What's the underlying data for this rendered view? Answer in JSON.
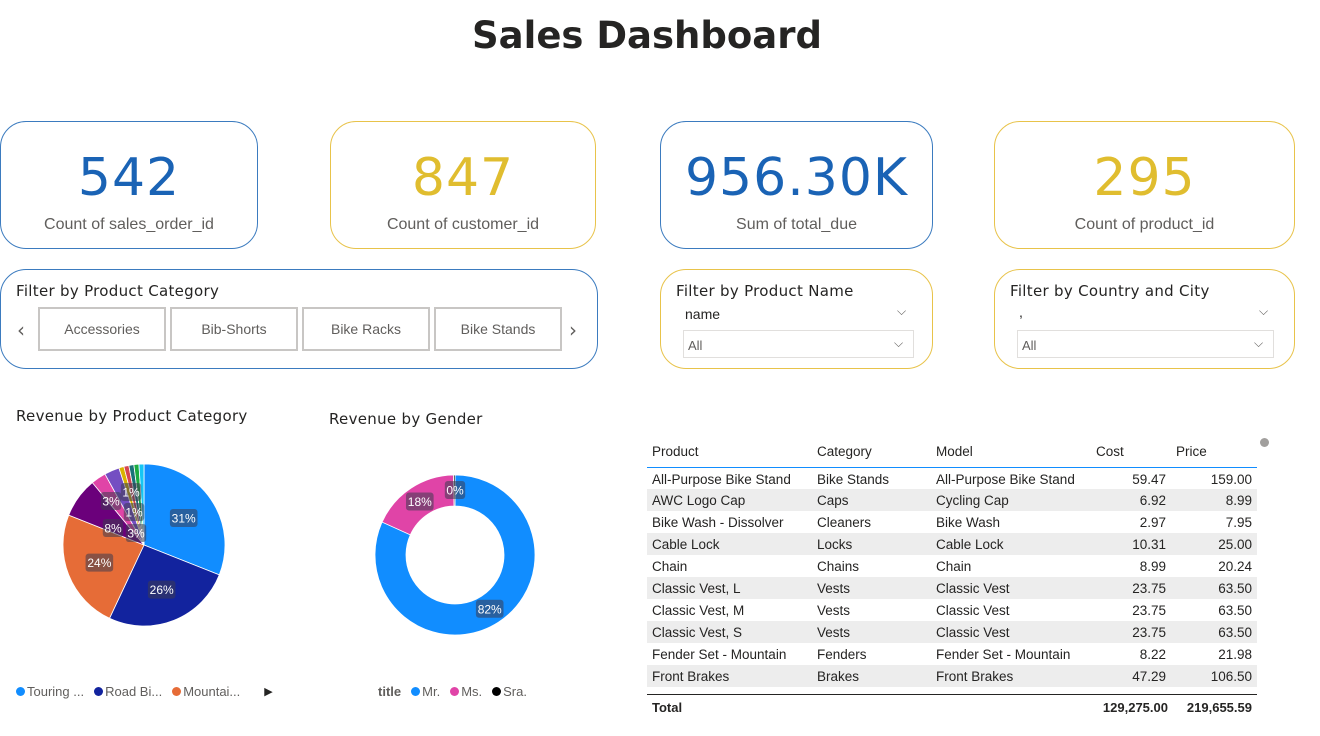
{
  "title": "Sales Dashboard",
  "kpis": [
    {
      "value": "542",
      "label": "Count of sales_order_id",
      "color": "#1a63b5"
    },
    {
      "value": "847",
      "label": "Count of customer_id",
      "color": "#e0bd2f"
    },
    {
      "value": "956.30K",
      "label": "Sum of total_due",
      "color": "#1a63b5"
    },
    {
      "value": "295",
      "label": "Count of product_id",
      "color": "#e0bd2f"
    }
  ],
  "category_slicer": {
    "title": "Filter by Product Category",
    "tiles": [
      "Accessories",
      "Bib-Shorts",
      "Bike Racks",
      "Bike Stands"
    ],
    "prev_icon": "chevron-left-icon",
    "next_icon": "chevron-right-icon"
  },
  "product_slicer": {
    "title": "Filter by Product Name",
    "field": "name",
    "value": "All"
  },
  "country_slicer": {
    "title": "Filter by Country and City",
    "field": ",",
    "value": "All"
  },
  "chart_data": [
    {
      "type": "pie",
      "title": "Revenue by Product Category",
      "slices": [
        {
          "name": "Touring ...",
          "value": 31,
          "label": "31%",
          "color": "#118dff"
        },
        {
          "name": "Road Bi...",
          "value": 26,
          "label": "26%",
          "color": "#12239e"
        },
        {
          "name": "Mountai...",
          "value": 24,
          "label": "24%",
          "color": "#e66c37"
        },
        {
          "name": "",
          "value": 8,
          "label": "8%",
          "color": "#6b007b"
        },
        {
          "name": "",
          "value": 3,
          "label": "3%",
          "color": "#e044a7"
        },
        {
          "name": "",
          "value": 3,
          "label": "3%",
          "color": "#744ec2"
        },
        {
          "name": "",
          "value": 1,
          "label": "1%",
          "color": "#d9b300"
        },
        {
          "name": "",
          "value": 1,
          "label": "1%",
          "color": "#d64550"
        },
        {
          "name": "",
          "value": 1,
          "label": "",
          "color": "#197278"
        },
        {
          "name": "",
          "value": 1,
          "label": "",
          "color": "#1aab40"
        },
        {
          "name": "",
          "value": 1,
          "label": "",
          "color": "#15c6f4"
        }
      ],
      "legend": [
        "Touring ...",
        "Road Bi...",
        "Mountai..."
      ],
      "legend_placement": "bottom"
    },
    {
      "type": "donut",
      "title": "Revenue by Gender",
      "slices": [
        {
          "name": "Mr.",
          "value": 82,
          "label": "82%",
          "color": "#118dff"
        },
        {
          "name": "Ms.",
          "value": 18,
          "label": "18%",
          "color": "#e044a7"
        },
        {
          "name": "Sra.",
          "value": 0.3,
          "label": "0%",
          "color": "#000000"
        }
      ],
      "legend_title": "title",
      "legend": [
        "Mr.",
        "Ms.",
        "Sra."
      ],
      "legend_placement": "bottom"
    }
  ],
  "table": {
    "columns": [
      "Product",
      "Category",
      "Model",
      "Cost",
      "Price"
    ],
    "rows": [
      [
        "All-Purpose Bike Stand",
        "Bike Stands",
        "All-Purpose Bike Stand",
        "59.47",
        "159.00"
      ],
      [
        "AWC Logo Cap",
        "Caps",
        "Cycling Cap",
        "6.92",
        "8.99"
      ],
      [
        "Bike Wash - Dissolver",
        "Cleaners",
        "Bike Wash",
        "2.97",
        "7.95"
      ],
      [
        "Cable Lock",
        "Locks",
        "Cable Lock",
        "10.31",
        "25.00"
      ],
      [
        "Chain",
        "Chains",
        "Chain",
        "8.99",
        "20.24"
      ],
      [
        "Classic Vest, L",
        "Vests",
        "Classic Vest",
        "23.75",
        "63.50"
      ],
      [
        "Classic Vest, M",
        "Vests",
        "Classic Vest",
        "23.75",
        "63.50"
      ],
      [
        "Classic Vest, S",
        "Vests",
        "Classic Vest",
        "23.75",
        "63.50"
      ],
      [
        "Fender Set - Mountain",
        "Fenders",
        "Fender Set - Mountain",
        "8.22",
        "21.98"
      ],
      [
        "Front Brakes",
        "Brakes",
        "Front Brakes",
        "47.29",
        "106.50"
      ]
    ],
    "total_label": "Total",
    "total_cost": "129,275.00",
    "total_price": "219,655.59"
  }
}
